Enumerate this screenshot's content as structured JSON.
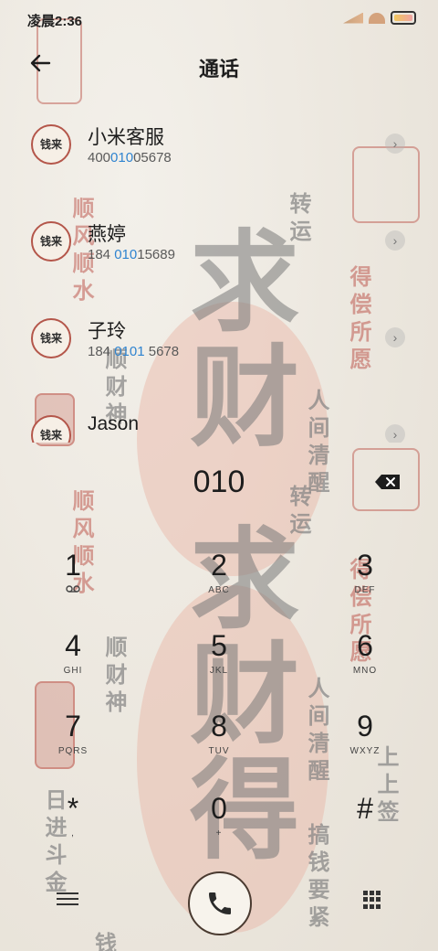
{
  "status_bar": {
    "time": "凌晨2:36"
  },
  "header": {
    "title": "通话"
  },
  "contacts": [
    {
      "avatar": "钱来",
      "name": "小米客服",
      "number_parts": [
        "400",
        "010",
        "05678"
      ]
    },
    {
      "avatar": "钱来",
      "name": "燕婷",
      "number_parts": [
        "184 ",
        "010",
        "15689"
      ]
    },
    {
      "avatar": "钱来",
      "name": "子玲",
      "number_parts": [
        "184 ",
        "0101",
        " 5678"
      ]
    },
    {
      "avatar": "钱来",
      "name": "Jason",
      "number_parts": [
        "",
        "",
        ""
      ]
    }
  ],
  "dialer": {
    "input": "010",
    "keys": [
      {
        "digit": "1",
        "letters": "voicemail-icon"
      },
      {
        "digit": "2",
        "letters": "ABC"
      },
      {
        "digit": "3",
        "letters": "DEF"
      },
      {
        "digit": "4",
        "letters": "GHI"
      },
      {
        "digit": "5",
        "letters": "JKL"
      },
      {
        "digit": "6",
        "letters": "MNO"
      },
      {
        "digit": "7",
        "letters": "PQRS"
      },
      {
        "digit": "8",
        "letters": "TUV"
      },
      {
        "digit": "9",
        "letters": "WXYZ"
      },
      {
        "digit": "*",
        "letters": ","
      },
      {
        "digit": "0",
        "letters": "+"
      },
      {
        "digit": "#",
        "letters": ""
      }
    ]
  },
  "background_art": {
    "big_chars_top": [
      "求",
      "财"
    ],
    "big_chars_bottom": [
      "求",
      "财",
      "得"
    ],
    "phrases": [
      "转运",
      "顺风顺水",
      "得偿所愿",
      "顺财神",
      "人间清醒",
      "搞钱要紧",
      "日进斗金",
      "上上签",
      "钱"
    ]
  },
  "colors": {
    "accent_blue": "#2f84d0",
    "seal_red": "#b4564a",
    "paper": "#efebe4"
  }
}
